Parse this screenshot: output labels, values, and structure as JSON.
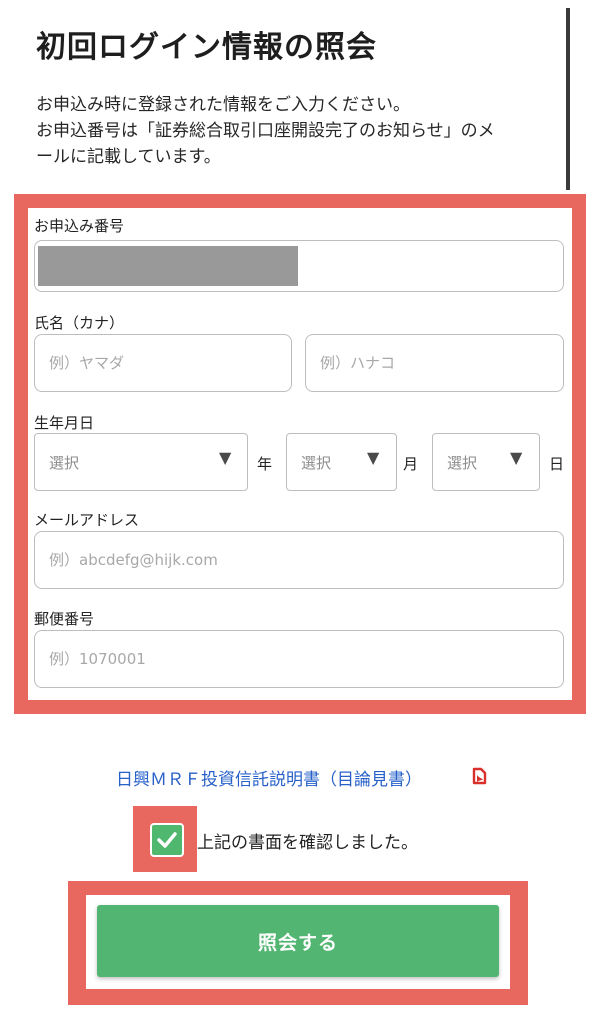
{
  "page_title": "初回ログイン情報の照会",
  "intro": {
    "line1": "お申込み時に登録された情報をご入力ください。",
    "line2": "お申込番号は「証券総合取引口座開設完了のお知らせ」のメ",
    "line3": "ールに記載しています。"
  },
  "form": {
    "application_number": {
      "label": "お申込み番号",
      "value_masked": true
    },
    "name_kana": {
      "label": "氏名（カナ）",
      "last_placeholder": "例）ヤマダ",
      "first_placeholder": "例）ハナコ"
    },
    "birthdate": {
      "label": "生年月日",
      "year": {
        "selected": "選択",
        "unit": "年"
      },
      "month": {
        "selected": "選択",
        "unit": "月"
      },
      "day": {
        "selected": "選択",
        "unit": "日"
      },
      "arrow": "▼"
    },
    "email": {
      "label": "メールアドレス",
      "placeholder": "例）abcdefg@hijk.com"
    },
    "postal_code": {
      "label": "郵便番号",
      "placeholder": "例）1070001"
    }
  },
  "document_link": {
    "label": "日興ＭＲＦ投資信託説明書（目論見書）",
    "icon": "pdf-icon"
  },
  "confirm_checkbox": {
    "label": "上記の書面を確認しました。",
    "checked": true
  },
  "submit_button": {
    "label": "照会する"
  },
  "colors": {
    "highlight": "#e8675f",
    "primary_green": "#52b571",
    "link_blue": "#2760c9",
    "pdf_red": "#d9302b"
  }
}
